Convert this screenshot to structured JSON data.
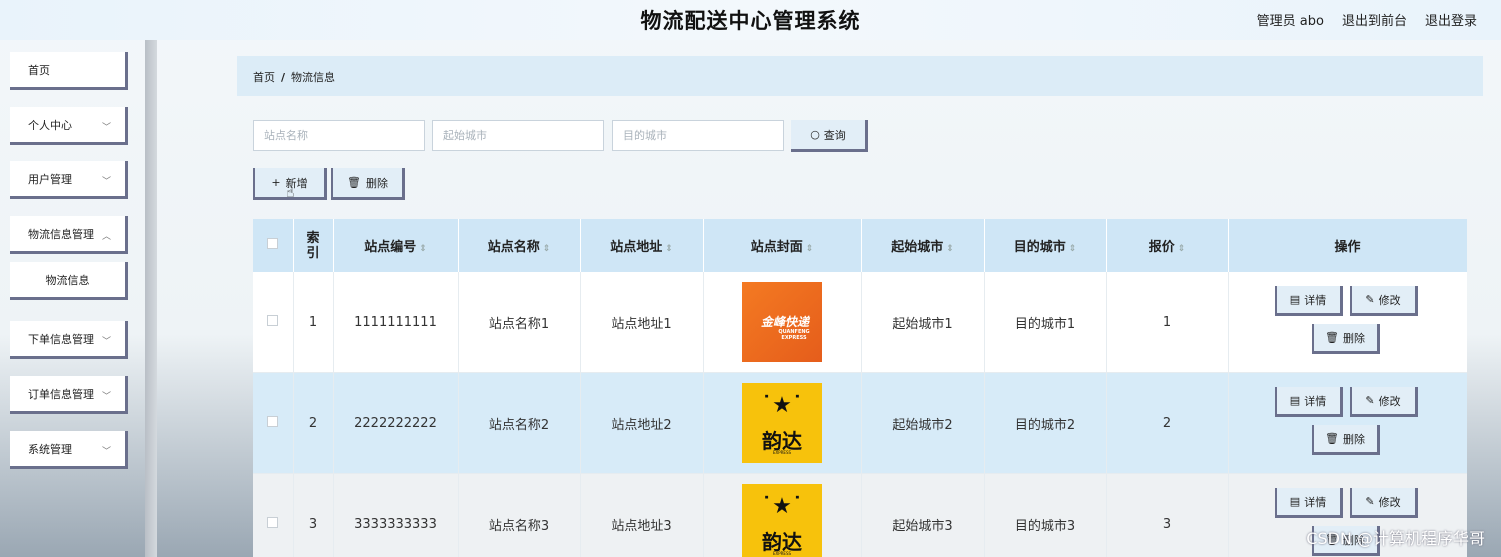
{
  "header": {
    "title": "物流配送中心管理系统",
    "admin": "管理员 abo",
    "to_front": "退出到前台",
    "logout": "退出登录"
  },
  "sidebar": {
    "items": [
      {
        "label": "首页"
      },
      {
        "label": "个人中心"
      },
      {
        "label": "用户管理"
      },
      {
        "label": "物流信息管理"
      },
      {
        "label": "物流信息"
      },
      {
        "label": "下单信息管理"
      },
      {
        "label": "订单信息管理"
      },
      {
        "label": "系统管理"
      }
    ]
  },
  "breadcrumb": {
    "home": "首页",
    "separator": "/",
    "current": "物流信息"
  },
  "search": {
    "station_name_placeholder": "站点名称",
    "origin_city_placeholder": "起始城市",
    "dest_city_placeholder": "目的城市",
    "search_label": "查询"
  },
  "actions": {
    "add_label": "新增",
    "delete_label": "删除"
  },
  "table": {
    "headers": [
      "索引",
      "站点编号",
      "站点名称",
      "站点地址",
      "站点封面",
      "起始城市",
      "目的城市",
      "报价",
      "操作"
    ],
    "rows": [
      {
        "index": "1",
        "code": "1111111111",
        "name": "站点名称1",
        "address": "站点地址1",
        "cover": "金峰快递",
        "cover_sub": "QUANFENG EXPRESS",
        "origin": "起始城市1",
        "dest": "目的城市1",
        "price": "1"
      },
      {
        "index": "2",
        "code": "2222222222",
        "name": "站点名称2",
        "address": "站点地址2",
        "cover": "韵达",
        "cover_sub": "EXPRESS",
        "origin": "起始城市2",
        "dest": "目的城市2",
        "price": "2"
      },
      {
        "index": "3",
        "code": "3333333333",
        "name": "站点名称3",
        "address": "站点地址3",
        "cover": "韵达",
        "cover_sub": "EXPRESS",
        "origin": "起始城市3",
        "dest": "目的城市3",
        "price": "3"
      }
    ],
    "op_detail": "详情",
    "op_edit": "修改",
    "op_delete": "删除"
  },
  "watermark": "CSDN @计算机程序华哥"
}
